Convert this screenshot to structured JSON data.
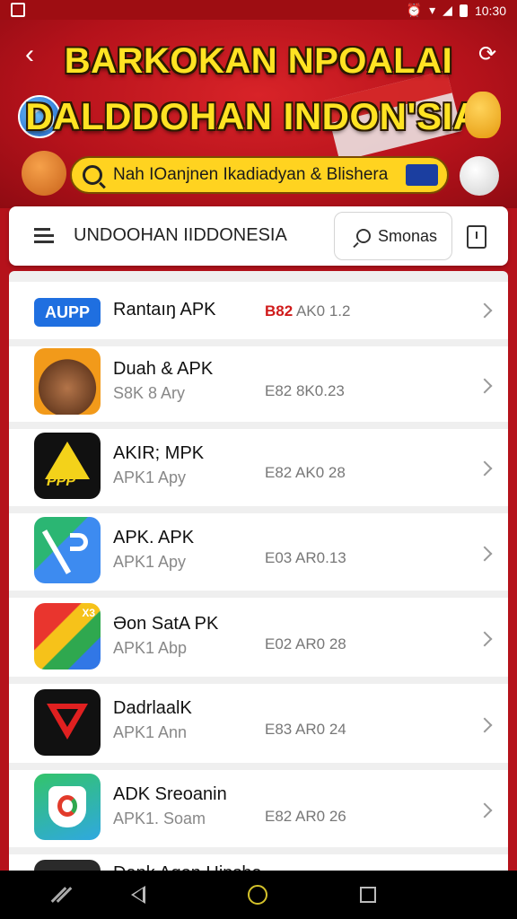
{
  "status_bar": {
    "time": "10:30"
  },
  "banner": {
    "title_line1": "BARKOKAN NPOALAI",
    "title_line2": "DALDDOHAN INDON'SIAI",
    "search_placeholder": "Nah IOanjnen Ikadiadyan & Blishera"
  },
  "toolbar": {
    "title": "UNDOOHAN IIDDONESIA",
    "search_label": "Smonas"
  },
  "apps": [
    {
      "name": "Rantaıŋ APK",
      "sub": "",
      "meta_hl": "B82",
      "meta": " AK0 1.2",
      "icon": "aupp-icon",
      "icon_text": "AUPP"
    },
    {
      "name": "Duah & APK",
      "sub": "S8K 8 Ary",
      "meta_hl": "",
      "meta": "E82 8K0.23",
      "icon": "monkey-icon",
      "icon_text": ""
    },
    {
      "name": "AKIR; MPK",
      "sub": "APK1 Apy",
      "meta_hl": "",
      "meta": "E82 AK0 28",
      "icon": "triangle-a-icon",
      "icon_text": "PPP"
    },
    {
      "name": "APK. APK",
      "sub": "APK1 Apy",
      "meta_hl": "",
      "meta": "E03 AR0.13",
      "icon": "play-store-icon",
      "icon_text": ""
    },
    {
      "name": "Əon SatA PK",
      "sub": "APK1 Abp",
      "meta_hl": "",
      "meta": "E02 AR0 28",
      "icon": "colorful-a-icon",
      "icon_text": "X3"
    },
    {
      "name": "DadrlaalK",
      "sub": "APK1 Ann",
      "meta_hl": "",
      "meta": "E83 AR0 24",
      "icon": "red-triangle-icon",
      "icon_text": ""
    },
    {
      "name": "ADK Sreoanin",
      "sub": "APK1. Soam",
      "meta_hl": "",
      "meta": "E82 AR0 26",
      "icon": "shield-logo-icon",
      "icon_text": ""
    },
    {
      "name": "Dank Aqon Hipsha",
      "sub": "",
      "meta_hl": "",
      "meta": "",
      "icon": "dark-app-icon",
      "icon_text": ""
    }
  ]
}
